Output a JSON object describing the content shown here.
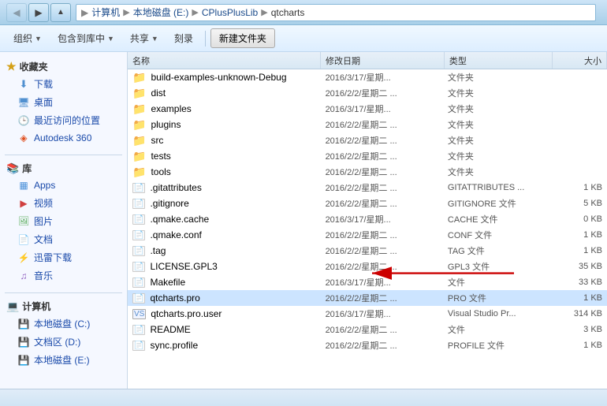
{
  "titlebar": {
    "back_btn": "◀",
    "forward_btn": "▶",
    "up_btn": "▲",
    "address": {
      "parts": [
        "计算机",
        "本地磁盘 (E:)",
        "CPlusPlusLib",
        "qtcharts"
      ],
      "sep": "▶"
    }
  },
  "toolbar": {
    "organize_label": "组织",
    "include_in_library_label": "包含到库中",
    "share_label": "共享",
    "burn_label": "刻录",
    "new_folder_label": "新建文件夹"
  },
  "sidebar": {
    "favorites_label": "收藏夹",
    "favorites_items": [
      {
        "label": "下载",
        "icon": "download"
      },
      {
        "label": "桌面",
        "icon": "desktop"
      },
      {
        "label": "最近访问的位置",
        "icon": "recent"
      },
      {
        "label": "Autodesk 360",
        "icon": "autodesk"
      }
    ],
    "libraries_label": "库",
    "library_items": [
      {
        "label": "Apps",
        "icon": "apps"
      },
      {
        "label": "视频",
        "icon": "video"
      },
      {
        "label": "图片",
        "icon": "photo"
      },
      {
        "label": "文档",
        "icon": "doc"
      },
      {
        "label": "迅雷下载",
        "icon": "download2"
      },
      {
        "label": "音乐",
        "icon": "music"
      }
    ],
    "computer_label": "计算机",
    "computer_items": [
      {
        "label": "本地磁盘 (C:)",
        "icon": "localdisk"
      },
      {
        "label": "文档区 (D:)",
        "icon": "localdisk"
      },
      {
        "label": "本地磁盘 (E:)",
        "icon": "localdisk"
      }
    ]
  },
  "columns": {
    "name": "名称",
    "date": "修改日期",
    "type": "类型",
    "size": "大小"
  },
  "files": [
    {
      "name": "build-examples-unknown-Debug",
      "type": "folder",
      "date": "2016/3/17/星期...",
      "filetype": "文件夹",
      "size": ""
    },
    {
      "name": "dist",
      "type": "folder",
      "date": "2016/2/2/星期二 ...",
      "filetype": "文件夹",
      "size": ""
    },
    {
      "name": "examples",
      "type": "folder",
      "date": "2016/3/17/星期...",
      "filetype": "文件夹",
      "size": ""
    },
    {
      "name": "plugins",
      "type": "folder",
      "date": "2016/2/2/星期二 ...",
      "filetype": "文件夹",
      "size": ""
    },
    {
      "name": "src",
      "type": "folder",
      "date": "2016/2/2/星期二 ...",
      "filetype": "文件夹",
      "size": ""
    },
    {
      "name": "tests",
      "type": "folder",
      "date": "2016/2/2/星期二 ...",
      "filetype": "文件夹",
      "size": ""
    },
    {
      "name": "tools",
      "type": "folder",
      "date": "2016/2/2/星期二 ...",
      "filetype": "文件夹",
      "size": ""
    },
    {
      "name": ".gitattributes",
      "type": "file",
      "date": "2016/2/2/星期二 ...",
      "filetype": "GITATTRIBUTES ...",
      "size": "1 KB"
    },
    {
      "name": ".gitignore",
      "type": "file",
      "date": "2016/2/2/星期二 ...",
      "filetype": "GITIGNORE 文件",
      "size": "5 KB"
    },
    {
      "name": ".qmake.cache",
      "type": "file",
      "date": "2016/3/17/星期...",
      "filetype": "CACHE 文件",
      "size": "0 KB"
    },
    {
      "name": ".qmake.conf",
      "type": "file",
      "date": "2016/2/2/星期二 ...",
      "filetype": "CONF 文件",
      "size": "1 KB"
    },
    {
      "name": ".tag",
      "type": "file",
      "date": "2016/2/2/星期二 ...",
      "filetype": "TAG 文件",
      "size": "1 KB"
    },
    {
      "name": "LICENSE.GPL3",
      "type": "file",
      "date": "2016/2/2/星期二 ...",
      "filetype": "GPL3 文件",
      "size": "35 KB"
    },
    {
      "name": "Makefile",
      "type": "file",
      "date": "2016/3/17/星期...",
      "filetype": "文件",
      "size": "33 KB"
    },
    {
      "name": "qtcharts.pro",
      "type": "file-pro",
      "date": "2016/2/2/星期二 ...",
      "filetype": "PRO 文件",
      "size": "1 KB"
    },
    {
      "name": "qtcharts.pro.user",
      "type": "file-vs",
      "date": "2016/3/17/星期...",
      "filetype": "Visual Studio Pr...",
      "size": "314 KB"
    },
    {
      "name": "README",
      "type": "file",
      "date": "2016/2/2/星期二 ...",
      "filetype": "文件",
      "size": "3 KB"
    },
    {
      "name": "sync.profile",
      "type": "file",
      "date": "2016/2/2/星期二 ...",
      "filetype": "PROFILE 文件",
      "size": "1 KB"
    }
  ],
  "status": {
    "text": ""
  }
}
